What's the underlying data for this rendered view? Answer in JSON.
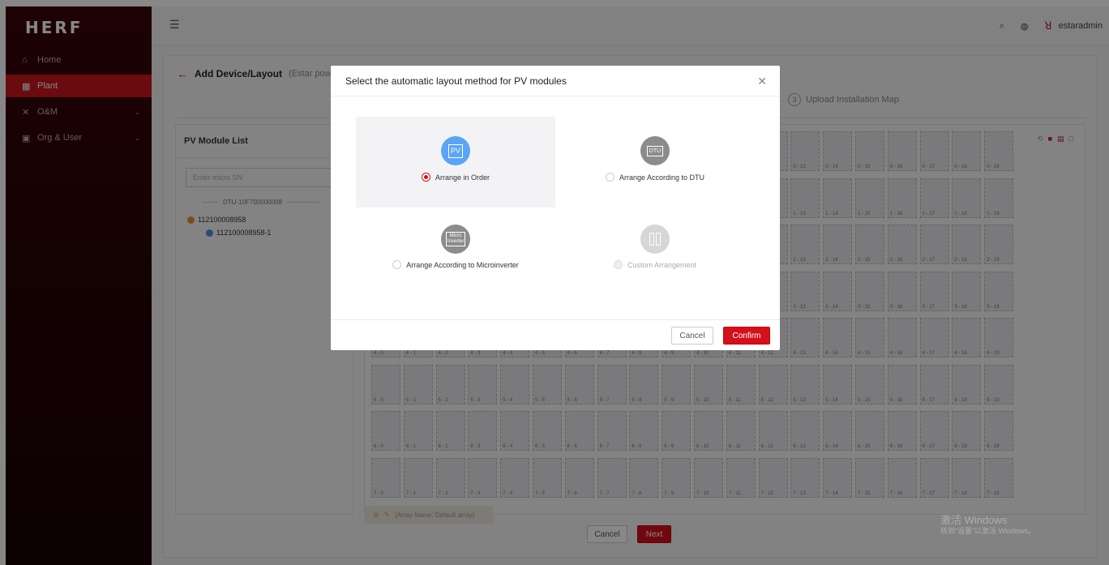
{
  "app": {
    "logo": "HERF"
  },
  "sidebar": {
    "items": [
      {
        "label": "Home",
        "icon": "home-icon"
      },
      {
        "label": "Plant",
        "icon": "plant-icon",
        "active": true
      },
      {
        "label": "O&M",
        "icon": "tools-icon",
        "has_children": true
      },
      {
        "label": "Org & User",
        "icon": "org-icon",
        "has_children": true
      }
    ]
  },
  "header": {
    "username": "estaradmin"
  },
  "page": {
    "title": "Add Device/Layout",
    "subtitle": "(Estar power sta",
    "step3_number": "3",
    "step3_label": "Upload Installation Map",
    "cancel_label": "Cancel",
    "next_label": "Next"
  },
  "pv_list": {
    "title": "PV Module List",
    "search_placeholder": "Enter micro SN",
    "dtu": "DTU-10F700000008",
    "micro": "112100008958",
    "module": "112100008958-1"
  },
  "array": {
    "name_label": "(Array Name: Default array)"
  },
  "grid": {
    "rows": 8,
    "cols": 20
  },
  "modal": {
    "title": "Select the automatic layout method for PV modules",
    "options": [
      {
        "label": "Arrange in Order",
        "icon_text": "PV",
        "selected": true,
        "disabled": false,
        "color": "#5aa5f5"
      },
      {
        "label": "Arrange According to DTU",
        "icon_text": "DTU",
        "selected": false,
        "disabled": false,
        "color": "#8c8c8c"
      },
      {
        "label": "Arrange According to Microinverter",
        "icon_text": "Micro Inverter",
        "selected": false,
        "disabled": false,
        "color": "#8c8c8c"
      },
      {
        "label": "Custom Arrangement",
        "icon_text": "",
        "selected": false,
        "disabled": true,
        "color": "#d6d6d6"
      }
    ],
    "cancel_label": "Cancel",
    "confirm_label": "Confirm"
  },
  "watermark": {
    "line1": "激活 Windows",
    "line2": "转到“设置”以激活 Windows。"
  },
  "colors": {
    "brand": "#d3101b",
    "sidebar": "#2a0407"
  }
}
